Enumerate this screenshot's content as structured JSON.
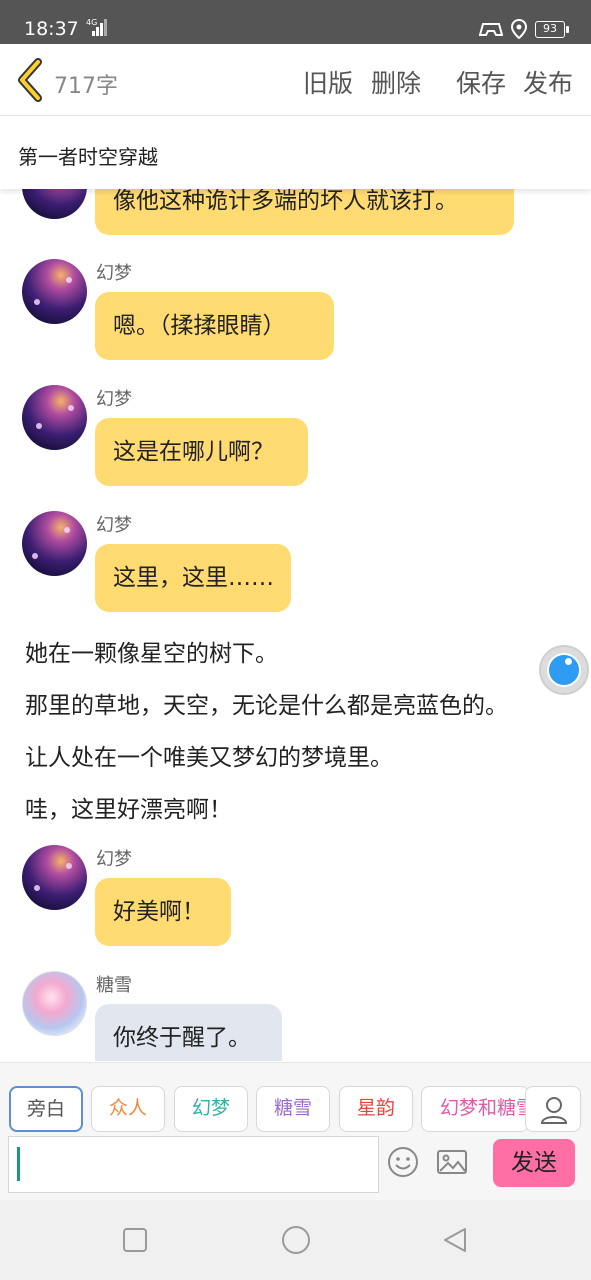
{
  "status": {
    "time": "18:37",
    "network": "4G",
    "battery": "93"
  },
  "header": {
    "word_count": "717字",
    "actions": {
      "old": "旧版",
      "delete": "删除",
      "save": "保存",
      "publish": "发布"
    }
  },
  "title": "第一者时空穿越",
  "messages": {
    "m0": {
      "text": "像他这种诡计多端的坏人就该打。"
    },
    "m1": {
      "name": "幻梦",
      "text": "嗯。（揉揉眼睛）"
    },
    "m2": {
      "name": "幻梦",
      "text": "这是在哪儿啊？"
    },
    "m3": {
      "name": "幻梦",
      "text": "这里，这里……"
    },
    "n1": "她在一颗像星空的树下。",
    "n2": "那里的草地，天空，无论是什么都是亮蓝色的。",
    "n3": "让人处在一个唯美又梦幻的梦境里。",
    "n4": "哇，这里好漂亮啊！",
    "m4": {
      "name": "幻梦",
      "text": "好美啊！"
    },
    "m5": {
      "name": "糖雪",
      "text": "你终于醒了。"
    }
  },
  "roles": [
    {
      "label": "旁白",
      "color": "#555555"
    },
    {
      "label": "众人",
      "color": "#f08a3c"
    },
    {
      "label": "幻梦",
      "color": "#2bb3a3"
    },
    {
      "label": "糖雪",
      "color": "#9b6ad0"
    },
    {
      "label": "星韵",
      "color": "#e8453c"
    },
    {
      "label": "幻梦和糖雪",
      "color": "#e05aa7"
    }
  ],
  "composer": {
    "send_label": "发送",
    "input_value": ""
  },
  "colors": {
    "bubble_main": "#ffdb72",
    "bubble_other": "#e1e6ef",
    "send": "#ff6fa6",
    "accent": "#2d9cf2"
  }
}
